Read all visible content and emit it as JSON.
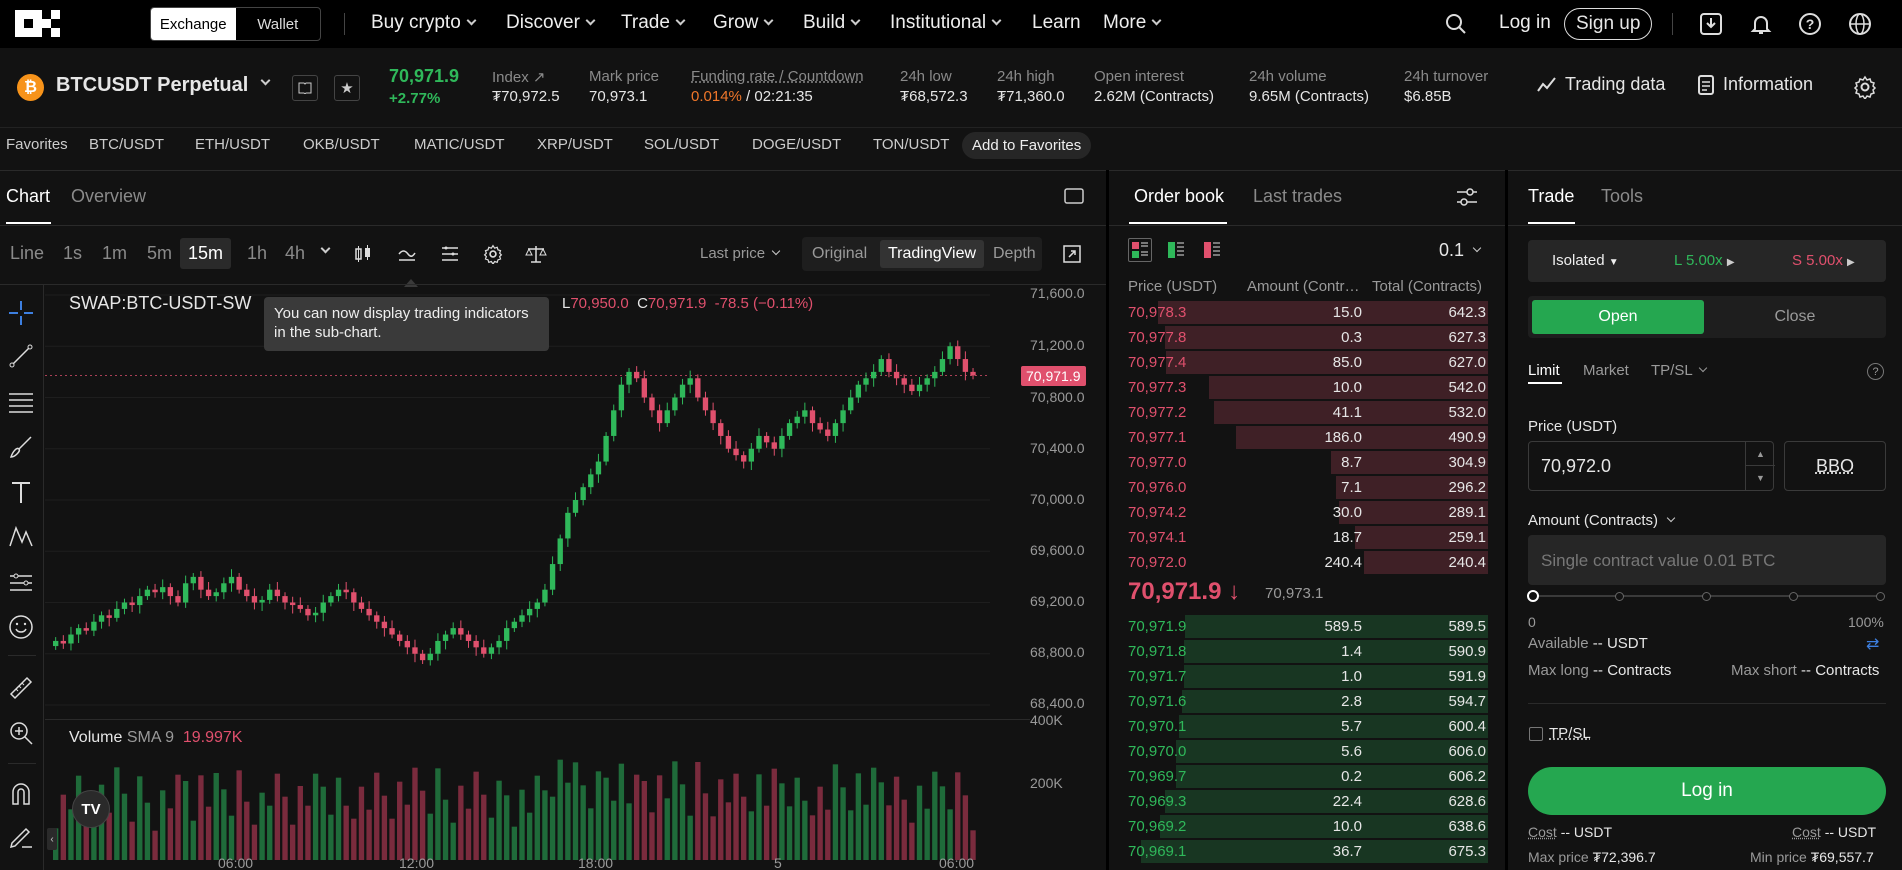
{
  "nav": {
    "exchange": "Exchange",
    "wallet": "Wallet",
    "menu": [
      "Buy crypto",
      "Discover",
      "Trade",
      "Grow",
      "Build",
      "Institutional",
      "Learn",
      "More"
    ],
    "login": "Log in",
    "signup": "Sign up"
  },
  "ticker": {
    "symbol": "BTCUSDT Perpetual",
    "last": "70,971.9",
    "change": "+2.77%",
    "index_label": "Index",
    "index_value": "₮70,972.5",
    "mark_label": "Mark price",
    "mark_value": "70,973.1",
    "funding_label": "Funding rate / Countdown",
    "funding_rate": "0.014%",
    "funding_countdown": " / 02:21:35",
    "low_label": "24h low",
    "low_value": "₮68,572.3",
    "high_label": "24h high",
    "high_value": "₮71,360.0",
    "oi_label": "Open interest",
    "oi_value": "2.62M (Contracts)",
    "vol_label": "24h volume",
    "vol_value": "9.65M (Contracts)",
    "turn_label": "24h turnover",
    "turn_value": "$6.85B",
    "trading_data": "Trading data",
    "information": "Information"
  },
  "favorites": {
    "label": "Favorites",
    "items": [
      "BTC/USDT",
      "ETH/USDT",
      "OKB/USDT",
      "MATIC/USDT",
      "XRP/USDT",
      "SOL/USDT",
      "DOGE/USDT",
      "TON/USDT"
    ],
    "add": "Add to Favorites"
  },
  "chart": {
    "tabs": [
      "Chart",
      "Overview"
    ],
    "timeframes": [
      "Line",
      "1s",
      "1m",
      "5m",
      "15m",
      "1h",
      "4h"
    ],
    "active_tf": "15m",
    "price_type": "Last price",
    "views": [
      "Original",
      "TradingView",
      "Depth"
    ],
    "symbol_line": "SWAP:BTC-USDT-SW",
    "ohlc_l_label": "L",
    "ohlc_l": "70,950.0",
    "ohlc_c_label": "C",
    "ohlc_c": "70,971.9",
    "ohlc_chg": "-78.5 (−0.11%)",
    "tooltip": "You can now display trading indicators in the sub-chart.",
    "yticks": [
      "71,600.0",
      "71,200.0",
      "70,800.0",
      "70,400.0",
      "70,000.0",
      "69,600.0",
      "69,200.0",
      "68,800.0",
      "68,400.0"
    ],
    "price_tag": "70,971.9",
    "vol_label": "Volume",
    "vol_sma": "SMA 9",
    "vol_sma_val": "19.997K",
    "vol_ticks": [
      "400K",
      "200K"
    ],
    "xticks": [
      "06:00",
      "12:00",
      "18:00",
      "5",
      "06:00"
    ],
    "tv": "TV"
  },
  "chart_data": {
    "type": "candlestick",
    "interval": "15m",
    "ylim": [
      68400,
      71600
    ],
    "close": [
      68900,
      68880,
      68950,
      69000,
      68980,
      69050,
      69100,
      69080,
      69150,
      69200,
      69180,
      69250,
      69300,
      69280,
      69320,
      69250,
      69200,
      69350,
      69400,
      69300,
      69250,
      69280,
      69350,
      69400,
      69300,
      69250,
      69200,
      69220,
      69300,
      69250,
      69200,
      69180,
      69150,
      69100,
      69120,
      69200,
      69250,
      69300,
      69280,
      69200,
      69150,
      69100,
      69050,
      69000,
      68950,
      68900,
      68850,
      68800,
      68750,
      68800,
      68900,
      68950,
      69000,
      68950,
      68900,
      68850,
      68800,
      68850,
      68900,
      69000,
      69050,
      69100,
      69150,
      69200,
      69300,
      69500,
      69700,
      69900,
      70000,
      70100,
      70200,
      70300,
      70500,
      70700,
      70900,
      71000,
      70950,
      70800,
      70700,
      70600,
      70700,
      70800,
      70900,
      70950,
      70800,
      70700,
      70600,
      70500,
      70400,
      70350,
      70300,
      70400,
      70500,
      70450,
      70400,
      70500,
      70600,
      70650,
      70700,
      70600,
      70550,
      70500,
      70600,
      70700,
      70800,
      70900,
      70950,
      71000,
      71100,
      71000,
      70950,
      70900,
      70850,
      70900,
      70950,
      71000,
      71100,
      71200,
      71100,
      71000,
      70971.9
    ]
  },
  "orderbook": {
    "tabs": [
      "Order book",
      "Last trades"
    ],
    "precision": "0.1",
    "headers": [
      "Price (USDT)",
      "Amount (Contr…",
      "Total (Contracts)"
    ],
    "asks": [
      [
        "70,978.3",
        "15.0",
        "642.3"
      ],
      [
        "70,977.8",
        "0.3",
        "627.3"
      ],
      [
        "70,977.4",
        "85.0",
        "627.0"
      ],
      [
        "70,977.3",
        "10.0",
        "542.0"
      ],
      [
        "70,977.2",
        "41.1",
        "532.0"
      ],
      [
        "70,977.1",
        "186.0",
        "490.9"
      ],
      [
        "70,977.0",
        "8.7",
        "304.9"
      ],
      [
        "70,976.0",
        "7.1",
        "296.2"
      ],
      [
        "70,974.2",
        "30.0",
        "289.1"
      ],
      [
        "70,974.1",
        "18.7",
        "259.1"
      ],
      [
        "70,972.0",
        "240.4",
        "240.4"
      ]
    ],
    "last": "70,971.9",
    "mark": "70,973.1",
    "bids": [
      [
        "70,971.9",
        "589.5",
        "589.5"
      ],
      [
        "70,971.8",
        "1.4",
        "590.9"
      ],
      [
        "70,971.7",
        "1.0",
        "591.9"
      ],
      [
        "70,971.6",
        "2.8",
        "594.7"
      ],
      [
        "70,970.1",
        "5.7",
        "600.4"
      ],
      [
        "70,970.0",
        "5.6",
        "606.0"
      ],
      [
        "70,969.7",
        "0.2",
        "606.2"
      ],
      [
        "70,969.3",
        "22.4",
        "628.6"
      ],
      [
        "70,969.2",
        "10.0",
        "638.6"
      ],
      [
        "70,969.1",
        "36.7",
        "675.3"
      ]
    ]
  },
  "trade": {
    "tabs": [
      "Trade",
      "Tools"
    ],
    "margin": "Isolated",
    "long_lev": "L 5.00x",
    "short_lev": "S 5.00x",
    "open": "Open",
    "close": "Close",
    "order_types": [
      "Limit",
      "Market",
      "TP/SL"
    ],
    "price_label": "Price (USDT)",
    "price_value": "70,972.0",
    "bbo": "BBO",
    "amount_label": "Amount (Contracts)",
    "amount_placeholder": "Single contract value 0.01 BTC",
    "slider_min": "0",
    "slider_max": "100%",
    "available_label": "Available",
    "available_value": "-- USDT",
    "maxlong_label": "Max long",
    "maxlong_value": "-- Contracts",
    "maxshort_label": "Max short",
    "maxshort_value": "-- Contracts",
    "tpsl": "TP/SL",
    "login": "Log in",
    "cost_label": "Cost",
    "cost_value": "-- USDT",
    "cost2_value": "-- USDT",
    "maxprice_label": "Max price",
    "maxprice_value": "₮72,396.7",
    "minprice_label": "Min price",
    "minprice_value": "₮69,557.7"
  },
  "colors": {
    "up": "#2fb85a",
    "down": "#e0506d",
    "accent": "#25a750"
  }
}
